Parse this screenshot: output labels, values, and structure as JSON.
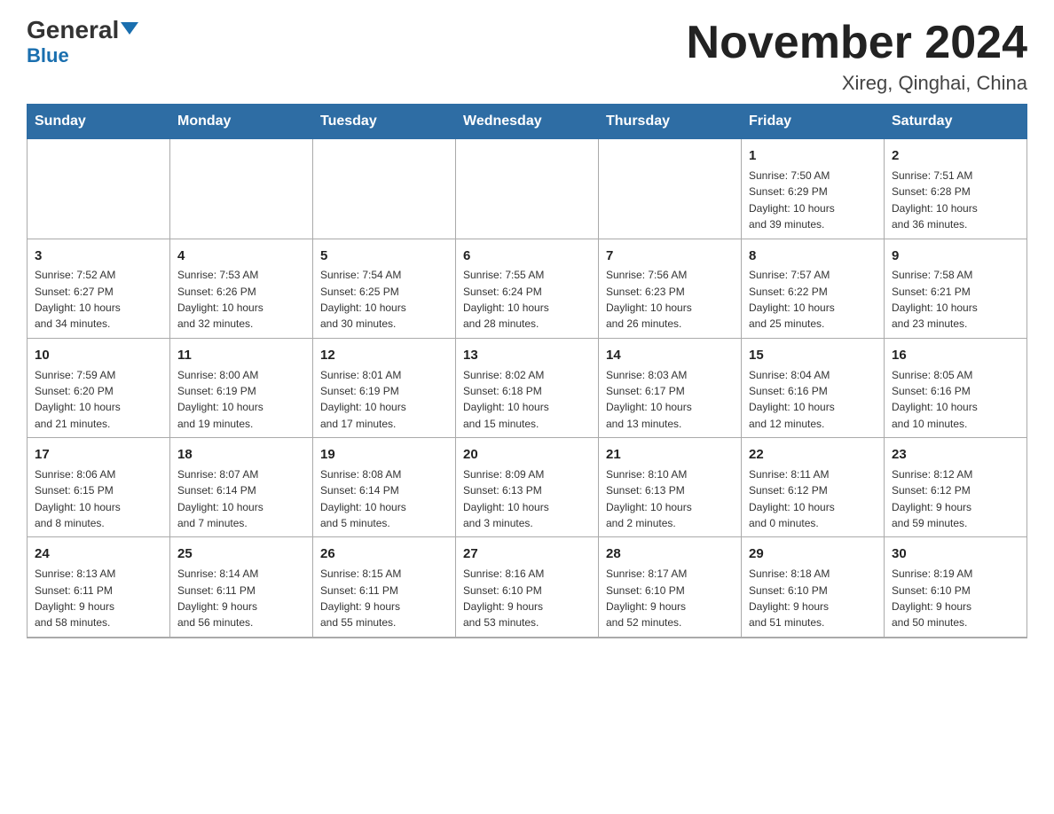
{
  "logo": {
    "text_general": "General",
    "text_blue": "Blue"
  },
  "title": "November 2024",
  "location": "Xireg, Qinghai, China",
  "days_of_week": [
    "Sunday",
    "Monday",
    "Tuesday",
    "Wednesday",
    "Thursday",
    "Friday",
    "Saturday"
  ],
  "weeks": [
    [
      {
        "day": "",
        "info": ""
      },
      {
        "day": "",
        "info": ""
      },
      {
        "day": "",
        "info": ""
      },
      {
        "day": "",
        "info": ""
      },
      {
        "day": "",
        "info": ""
      },
      {
        "day": "1",
        "info": "Sunrise: 7:50 AM\nSunset: 6:29 PM\nDaylight: 10 hours\nand 39 minutes."
      },
      {
        "day": "2",
        "info": "Sunrise: 7:51 AM\nSunset: 6:28 PM\nDaylight: 10 hours\nand 36 minutes."
      }
    ],
    [
      {
        "day": "3",
        "info": "Sunrise: 7:52 AM\nSunset: 6:27 PM\nDaylight: 10 hours\nand 34 minutes."
      },
      {
        "day": "4",
        "info": "Sunrise: 7:53 AM\nSunset: 6:26 PM\nDaylight: 10 hours\nand 32 minutes."
      },
      {
        "day": "5",
        "info": "Sunrise: 7:54 AM\nSunset: 6:25 PM\nDaylight: 10 hours\nand 30 minutes."
      },
      {
        "day": "6",
        "info": "Sunrise: 7:55 AM\nSunset: 6:24 PM\nDaylight: 10 hours\nand 28 minutes."
      },
      {
        "day": "7",
        "info": "Sunrise: 7:56 AM\nSunset: 6:23 PM\nDaylight: 10 hours\nand 26 minutes."
      },
      {
        "day": "8",
        "info": "Sunrise: 7:57 AM\nSunset: 6:22 PM\nDaylight: 10 hours\nand 25 minutes."
      },
      {
        "day": "9",
        "info": "Sunrise: 7:58 AM\nSunset: 6:21 PM\nDaylight: 10 hours\nand 23 minutes."
      }
    ],
    [
      {
        "day": "10",
        "info": "Sunrise: 7:59 AM\nSunset: 6:20 PM\nDaylight: 10 hours\nand 21 minutes."
      },
      {
        "day": "11",
        "info": "Sunrise: 8:00 AM\nSunset: 6:19 PM\nDaylight: 10 hours\nand 19 minutes."
      },
      {
        "day": "12",
        "info": "Sunrise: 8:01 AM\nSunset: 6:19 PM\nDaylight: 10 hours\nand 17 minutes."
      },
      {
        "day": "13",
        "info": "Sunrise: 8:02 AM\nSunset: 6:18 PM\nDaylight: 10 hours\nand 15 minutes."
      },
      {
        "day": "14",
        "info": "Sunrise: 8:03 AM\nSunset: 6:17 PM\nDaylight: 10 hours\nand 13 minutes."
      },
      {
        "day": "15",
        "info": "Sunrise: 8:04 AM\nSunset: 6:16 PM\nDaylight: 10 hours\nand 12 minutes."
      },
      {
        "day": "16",
        "info": "Sunrise: 8:05 AM\nSunset: 6:16 PM\nDaylight: 10 hours\nand 10 minutes."
      }
    ],
    [
      {
        "day": "17",
        "info": "Sunrise: 8:06 AM\nSunset: 6:15 PM\nDaylight: 10 hours\nand 8 minutes."
      },
      {
        "day": "18",
        "info": "Sunrise: 8:07 AM\nSunset: 6:14 PM\nDaylight: 10 hours\nand 7 minutes."
      },
      {
        "day": "19",
        "info": "Sunrise: 8:08 AM\nSunset: 6:14 PM\nDaylight: 10 hours\nand 5 minutes."
      },
      {
        "day": "20",
        "info": "Sunrise: 8:09 AM\nSunset: 6:13 PM\nDaylight: 10 hours\nand 3 minutes."
      },
      {
        "day": "21",
        "info": "Sunrise: 8:10 AM\nSunset: 6:13 PM\nDaylight: 10 hours\nand 2 minutes."
      },
      {
        "day": "22",
        "info": "Sunrise: 8:11 AM\nSunset: 6:12 PM\nDaylight: 10 hours\nand 0 minutes."
      },
      {
        "day": "23",
        "info": "Sunrise: 8:12 AM\nSunset: 6:12 PM\nDaylight: 9 hours\nand 59 minutes."
      }
    ],
    [
      {
        "day": "24",
        "info": "Sunrise: 8:13 AM\nSunset: 6:11 PM\nDaylight: 9 hours\nand 58 minutes."
      },
      {
        "day": "25",
        "info": "Sunrise: 8:14 AM\nSunset: 6:11 PM\nDaylight: 9 hours\nand 56 minutes."
      },
      {
        "day": "26",
        "info": "Sunrise: 8:15 AM\nSunset: 6:11 PM\nDaylight: 9 hours\nand 55 minutes."
      },
      {
        "day": "27",
        "info": "Sunrise: 8:16 AM\nSunset: 6:10 PM\nDaylight: 9 hours\nand 53 minutes."
      },
      {
        "day": "28",
        "info": "Sunrise: 8:17 AM\nSunset: 6:10 PM\nDaylight: 9 hours\nand 52 minutes."
      },
      {
        "day": "29",
        "info": "Sunrise: 8:18 AM\nSunset: 6:10 PM\nDaylight: 9 hours\nand 51 minutes."
      },
      {
        "day": "30",
        "info": "Sunrise: 8:19 AM\nSunset: 6:10 PM\nDaylight: 9 hours\nand 50 minutes."
      }
    ]
  ]
}
